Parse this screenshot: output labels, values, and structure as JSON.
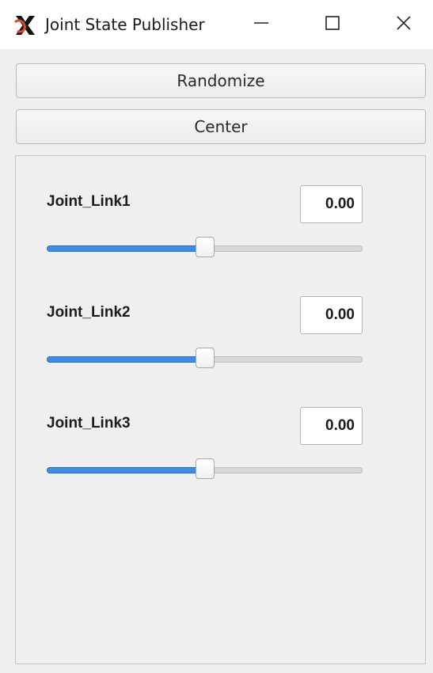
{
  "window": {
    "title": "Joint State Publisher",
    "icon": "ros-x-logo-icon",
    "controls": [
      "minimize-icon",
      "maximize-icon",
      "close-icon"
    ]
  },
  "buttons": {
    "randomize_label": "Randomize",
    "center_label": "Center"
  },
  "joints": [
    {
      "name": "Joint_Link1",
      "value": "0.00",
      "slider_level": 0.5
    },
    {
      "name": "Joint_Link2",
      "value": "0.00",
      "slider_level": 0.5
    },
    {
      "name": "Joint_Link3",
      "value": "0.00",
      "slider_level": 0.5
    }
  ],
  "colors": {
    "slider_accent": "#3a8ee6",
    "background": "#efefef"
  }
}
